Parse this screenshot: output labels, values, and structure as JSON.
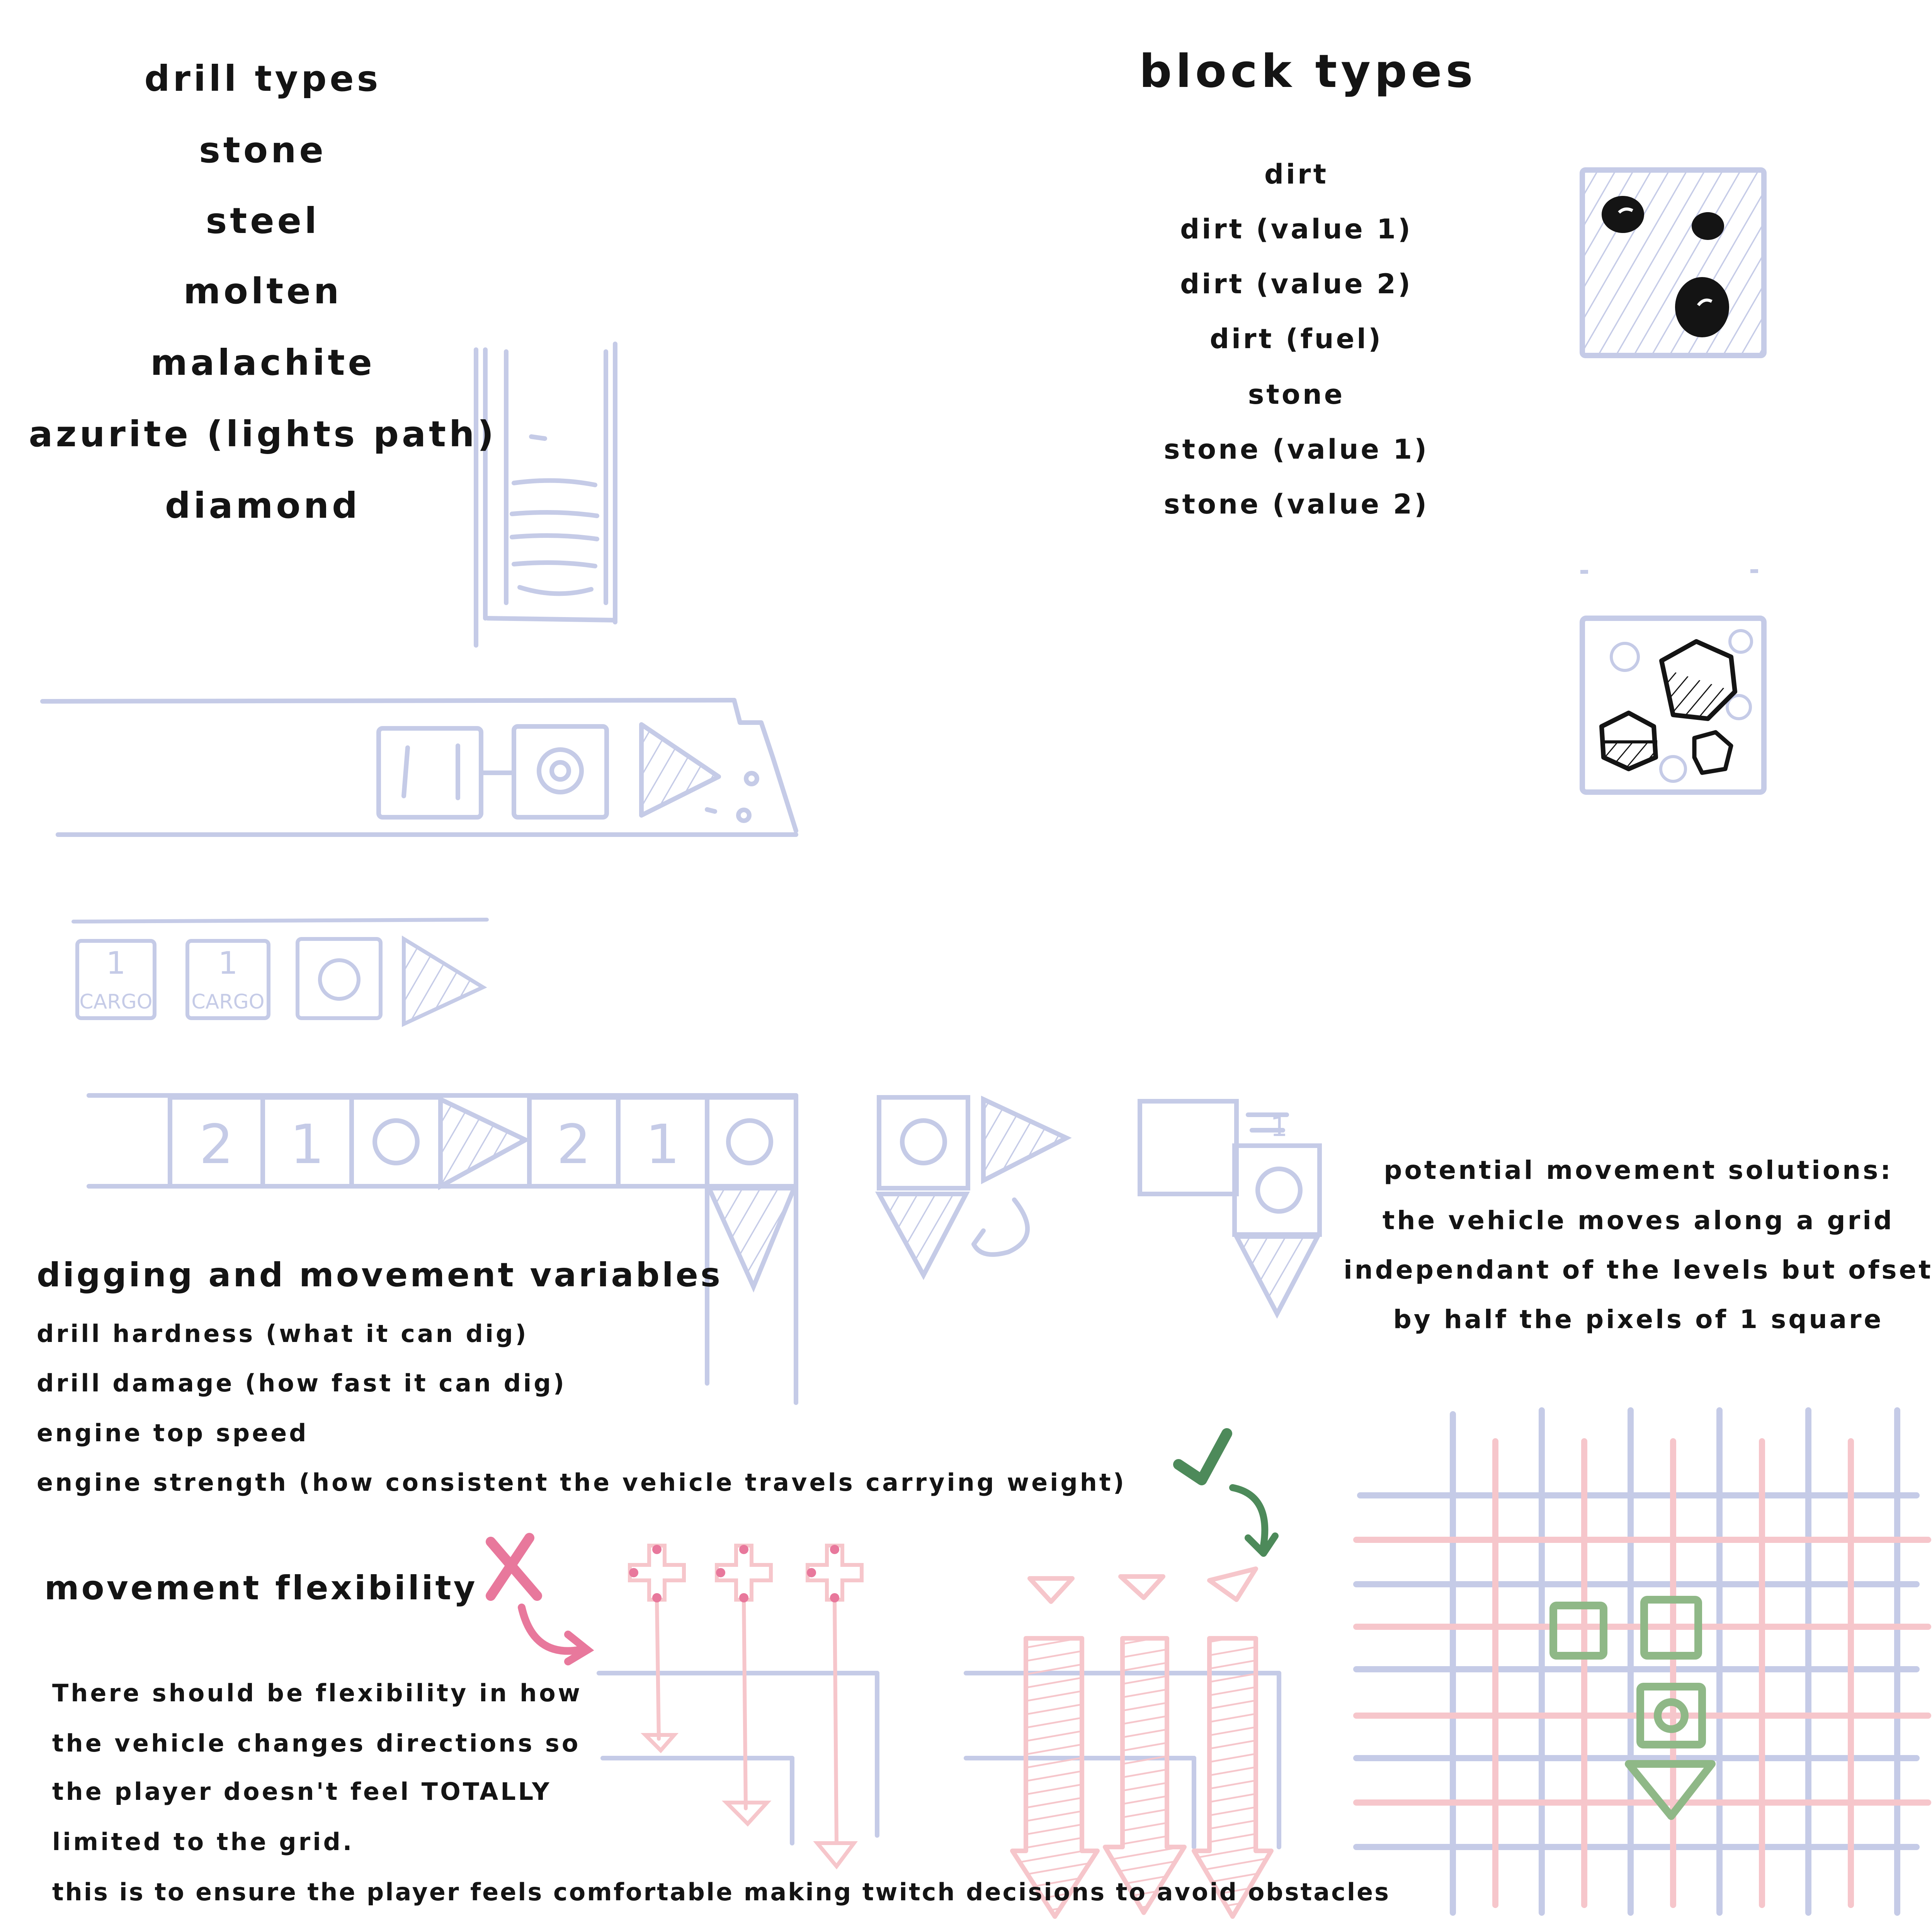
{
  "drill_types": {
    "heading": "drill types",
    "items": [
      "stone",
      "steel",
      "molten",
      "malachite",
      "azurite (lights path)",
      "diamond"
    ]
  },
  "block_types": {
    "heading": "block types",
    "items": [
      "dirt",
      "dirt (value 1)",
      "dirt (value 2)",
      "dirt (fuel)",
      "stone",
      "stone (value 1)",
      "stone (value 2)"
    ]
  },
  "sketch_labels": {
    "cargo_1_num": "1",
    "cargo_1_word": "CARGO",
    "cargo_2_num": "1",
    "cargo_2_word": "CARGO",
    "train_cells": [
      "2",
      "1",
      "2",
      "1"
    ],
    "turn_top_num": "1"
  },
  "digging_movement": {
    "heading": "digging and movement variables",
    "items": [
      "drill hardness (what it can dig)",
      "drill damage (how fast it can dig)",
      "engine top speed",
      "engine strength (how consistent the vehicle travels carrying weight)"
    ]
  },
  "movement_flexibility": {
    "heading": "movement flexibility",
    "body": [
      "There should be flexibility in how",
      "the vehicle changes directions so",
      "the player doesn't feel TOTALLY",
      "limited to the grid.",
      "this is to ensure the player feels comfortable making twitch decisions to avoid obstacles"
    ]
  },
  "potential_solutions": {
    "lines": [
      "potential movement solutions:",
      "the vehicle moves along a grid",
      "independant of the levels but ofset",
      "by half the pixels of 1 square"
    ]
  },
  "colors": {
    "sketch_blue": "#c5cbe7",
    "sketch_pink": "#f6c6cb",
    "cross_pink": "#e8789c",
    "check_green": "#4d8a5a",
    "square_green": "#8fb887",
    "ink": "#141414"
  },
  "marks": {
    "wrong": "x-mark-icon",
    "right": "check-mark-icon"
  }
}
